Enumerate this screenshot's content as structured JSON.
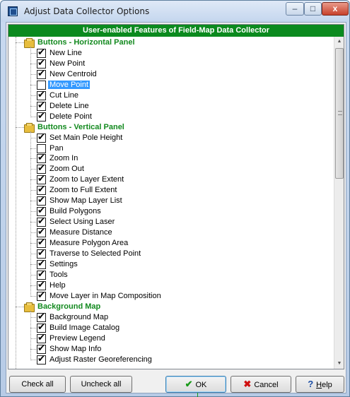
{
  "window": {
    "title": "Adjust Data Collector Options"
  },
  "title_controls": {
    "minimize": "–",
    "maximize": "□",
    "close": "x"
  },
  "header": "User-enabled Features of Field-Map Data Collector",
  "tree": [
    {
      "label": "Buttons - Horizontal Panel",
      "group": true
    },
    {
      "label": "New Line",
      "checked": true
    },
    {
      "label": "New Point",
      "checked": true
    },
    {
      "label": "New Centroid",
      "checked": true
    },
    {
      "label": "Move Point",
      "checked": false,
      "selected": true
    },
    {
      "label": "Cut Line",
      "checked": true
    },
    {
      "label": "Delete Line",
      "checked": true
    },
    {
      "label": "Delete Point",
      "checked": true
    },
    {
      "label": "Buttons - Vertical Panel",
      "group": true
    },
    {
      "label": "Set Main Pole Height",
      "checked": true
    },
    {
      "label": "Pan",
      "checked": false
    },
    {
      "label": "Zoom In",
      "checked": true
    },
    {
      "label": "Zoom Out",
      "checked": true
    },
    {
      "label": "Zoom to Layer Extent",
      "checked": true
    },
    {
      "label": "Zoom to Full Extent",
      "checked": true
    },
    {
      "label": "Show Map Layer List",
      "checked": true
    },
    {
      "label": "Build Polygons",
      "checked": true
    },
    {
      "label": "Select Using Laser",
      "checked": true
    },
    {
      "label": "Measure Distance",
      "checked": true
    },
    {
      "label": "Measure Polygon Area",
      "checked": true
    },
    {
      "label": "Traverse to Selected Point",
      "checked": true
    },
    {
      "label": "Settings",
      "checked": true
    },
    {
      "label": "Tools",
      "checked": true
    },
    {
      "label": "Help",
      "checked": true
    },
    {
      "label": "Move Layer in Map Composition",
      "checked": true
    },
    {
      "label": "Background Map",
      "group": true
    },
    {
      "label": "Background Map",
      "checked": true
    },
    {
      "label": "Build Image Catalog",
      "checked": true
    },
    {
      "label": "Preview Legend",
      "checked": true
    },
    {
      "label": "Show Map Info",
      "checked": true
    },
    {
      "label": "Adjust Raster Georeferencing",
      "checked": true
    }
  ],
  "buttons": {
    "check_all": "Check all",
    "uncheck_all": "Uncheck all",
    "ok": "OK",
    "cancel": "Cancel",
    "help_h": "H",
    "help_rest": "elp"
  },
  "scrollbar": {
    "up": "▲",
    "down": "▼"
  },
  "colors": {
    "header_bg": "#0b8a1e",
    "group_text": "#138a1f",
    "selection": "#3399ff"
  }
}
